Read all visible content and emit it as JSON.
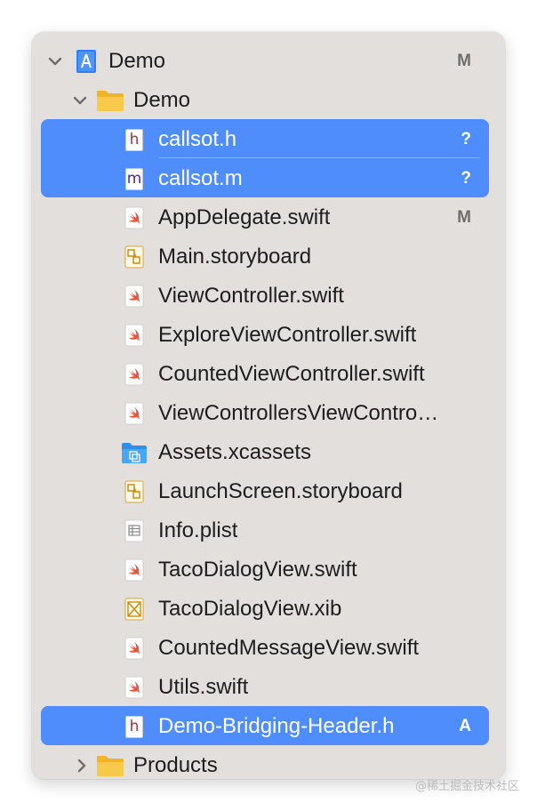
{
  "project": {
    "name": "Demo",
    "badge": "M"
  },
  "group": {
    "name": "Demo"
  },
  "files": [
    {
      "name": "callsot.h",
      "icon": "h-header-icon",
      "badge": "?",
      "selected": true
    },
    {
      "name": "callsot.m",
      "icon": "m-source-icon",
      "badge": "?",
      "selected": true
    },
    {
      "name": "AppDelegate.swift",
      "icon": "swift-file-icon",
      "badge": "M",
      "selected": false
    },
    {
      "name": "Main.storyboard",
      "icon": "storyboard-icon",
      "badge": "",
      "selected": false
    },
    {
      "name": "ViewController.swift",
      "icon": "swift-file-icon",
      "badge": "",
      "selected": false
    },
    {
      "name": "ExploreViewController.swift",
      "icon": "swift-file-icon",
      "badge": "",
      "selected": false
    },
    {
      "name": "CountedViewController.swift",
      "icon": "swift-file-icon",
      "badge": "",
      "selected": false
    },
    {
      "name": "ViewControllersViewContro…",
      "icon": "swift-file-icon",
      "badge": "",
      "selected": false
    },
    {
      "name": "Assets.xcassets",
      "icon": "asset-catalog-icon",
      "badge": "",
      "selected": false
    },
    {
      "name": "LaunchScreen.storyboard",
      "icon": "storyboard-icon",
      "badge": "",
      "selected": false
    },
    {
      "name": "Info.plist",
      "icon": "plist-icon",
      "badge": "",
      "selected": false
    },
    {
      "name": "TacoDialogView.swift",
      "icon": "swift-file-icon",
      "badge": "",
      "selected": false
    },
    {
      "name": "TacoDialogView.xib",
      "icon": "xib-icon",
      "badge": "",
      "selected": false
    },
    {
      "name": "CountedMessageView.swift",
      "icon": "swift-file-icon",
      "badge": "",
      "selected": false
    },
    {
      "name": "Utils.swift",
      "icon": "swift-file-icon",
      "badge": "",
      "selected": false
    },
    {
      "name": "Demo-Bridging-Header.h",
      "icon": "h-header-icon",
      "badge": "A",
      "selected": true
    }
  ],
  "products": {
    "name": "Products"
  },
  "watermark": "@稀土掘金技术社区",
  "colors": {
    "selection": "#4f8dfc",
    "panel": "#e3dfdd",
    "folder": "#f5c242",
    "swift": "#f05138"
  }
}
